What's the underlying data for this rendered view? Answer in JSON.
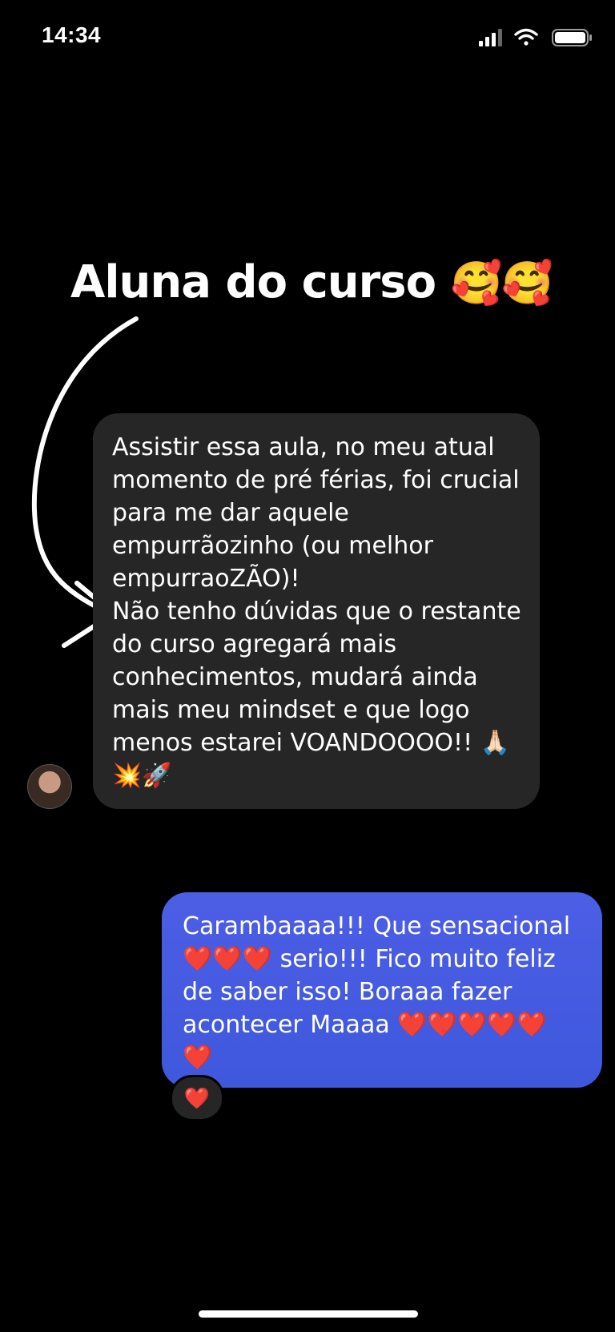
{
  "status_bar": {
    "time": "14:34",
    "signal_icon": "signal-icon",
    "wifi_icon": "wifi-icon",
    "battery_icon": "battery-icon"
  },
  "headline": {
    "text": "Aluna do curso",
    "emojis": "🥰🥰"
  },
  "received_message": {
    "lines": [
      "Assistir essa aula, no meu atual",
      "momento de pré férias, foi crucial",
      "para me dar aquele",
      "empurrãozinho (ou melhor",
      "empurraoZÃO)!",
      "Não tenho dúvidas que o restante",
      "do curso agregará mais",
      "conhecimentos, mudará ainda",
      "mais meu mindset e que logo",
      "menos estarei VOANDOOOO!! 🙏🏻",
      "💥🚀"
    ]
  },
  "sent_message": {
    "lines": [
      "Carambaaaa!!! Que sensacional",
      "❤️❤️❤️ serio!!! Fico muito feliz",
      "de saber isso! Boraaa fazer",
      "acontecer Maaaa ❤️❤️❤️❤️❤️",
      "❤️"
    ],
    "reaction": "❤️"
  },
  "colors": {
    "background": "#000000",
    "received_bubble": "#262626",
    "sent_bubble": "#4458e0"
  }
}
